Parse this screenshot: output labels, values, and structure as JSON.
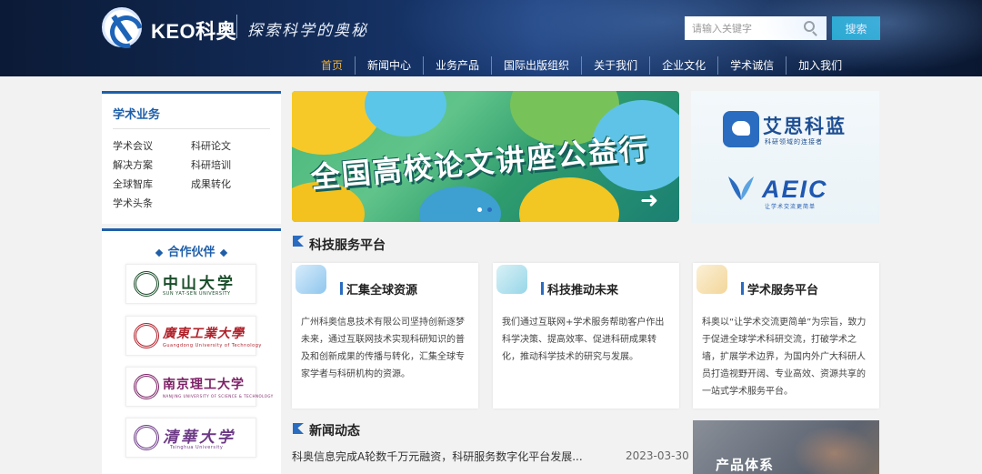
{
  "header": {
    "brand": "KEO科奥",
    "slogan": "探索科学的奥秘",
    "search_placeholder": "请输入关键字",
    "search_button": "搜索"
  },
  "nav": {
    "items": [
      "首页",
      "新闻中心",
      "业务产品",
      "国际出版组织",
      "关于我们",
      "企业文化",
      "学术诚信",
      "加入我们"
    ],
    "active_index": 0
  },
  "sidebar": {
    "business_title": "学术业务",
    "business_links": [
      "学术会议",
      "科研论文",
      "解决方案",
      "科研培训",
      "全球智库",
      "成果转化",
      "学术头条"
    ],
    "partners_title": "合作伙伴",
    "partners": [
      {
        "name": "中山大学",
        "en": "SUN YAT-SEN UNIVERSITY",
        "color": "#1a4d2a"
      },
      {
        "name": "廣東工業大學",
        "en": "Guangdong University of Technology",
        "color": "#b0212a"
      },
      {
        "name": "南京理工大学",
        "en": "NANJING UNIVERSITY OF SCIENCE & TECHNOLOGY",
        "color": "#7d1f66"
      },
      {
        "name": "清華大学",
        "en": "Tsinghua University",
        "color": "#6d3a86"
      }
    ]
  },
  "banner": {
    "title": "全国高校论文讲座公益行"
  },
  "brand_card": {
    "aisi_name": "艾思科蓝",
    "aisi_sub": "科研领域的连接者",
    "aeic_name": "AEIC",
    "aeic_sub": "让学术交流更简单"
  },
  "services": {
    "section_title": "科技服务平台",
    "cards": [
      {
        "title": "汇集全球资源",
        "desc": "广州科奥信息技术有限公司坚持创新逐梦未来，通过互联网技术实现科研知识的普及和创新成果的传播与转化，汇集全球专家学者与科研机构的资源。"
      },
      {
        "title": "科技推动未来",
        "desc": "我们通过互联网+学术服务帮助客户作出科学决策、提高效率、促进科研成果转化，推动科学技术的研究与发展。"
      },
      {
        "title": "学术服务平台",
        "desc": "科奥以“让学术交流更简单”为宗旨，致力于促进全球学术科研交流，打破学术之墙，扩展学术边界，为国内外广大科研人员打造视野开阔、专业高效、资源共享的一站式学术服务平台。"
      }
    ]
  },
  "news": {
    "section_title": "新闻动态",
    "items": [
      {
        "title": "科奥信息完成A轮数千万元融资，科研服务数字化平台发展...",
        "date": "2023-03-30"
      }
    ]
  },
  "products": {
    "title": "产品体系"
  },
  "colors": {
    "primary": "#1f5fa9",
    "accent": "#18a6c9",
    "nav_active": "#f2b233"
  }
}
